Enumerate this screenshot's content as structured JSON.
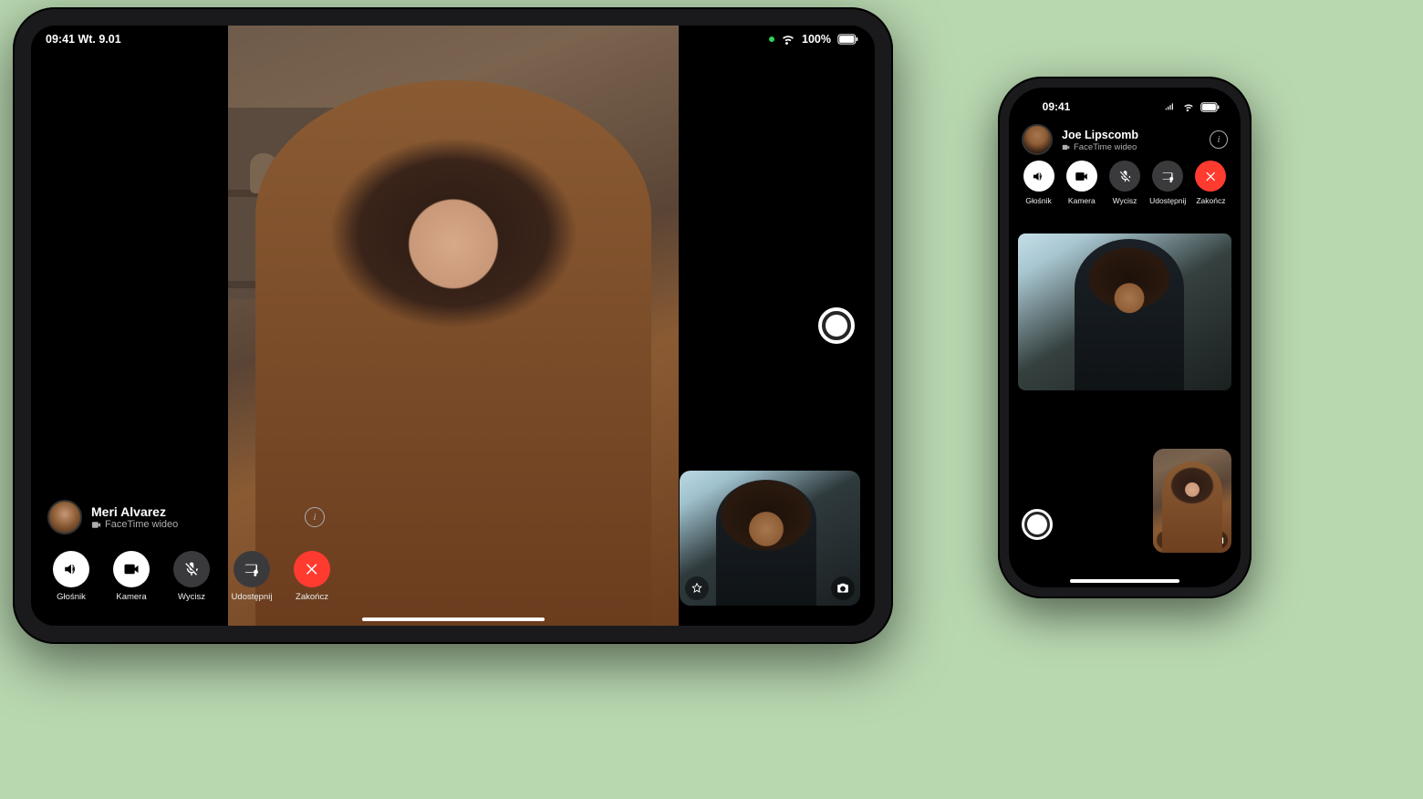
{
  "ipad": {
    "status": {
      "time_date": "09:41 Wt. 9.01",
      "battery": "100%"
    },
    "caller": {
      "name": "Meri Alvarez",
      "subtitle": "FaceTime wideo"
    },
    "controls": {
      "speaker": "Głośnik",
      "camera": "Kamera",
      "mute": "Wycisz",
      "share": "Udostępnij",
      "end": "Zakończ"
    }
  },
  "iphone": {
    "status": {
      "time": "09:41"
    },
    "caller": {
      "name": "Joe Lipscomb",
      "subtitle": "FaceTime wideo"
    },
    "controls": {
      "speaker": "Głośnik",
      "camera": "Kamera",
      "mute": "Wycisz",
      "share": "Udostępnij",
      "end": "Zakończ"
    }
  }
}
